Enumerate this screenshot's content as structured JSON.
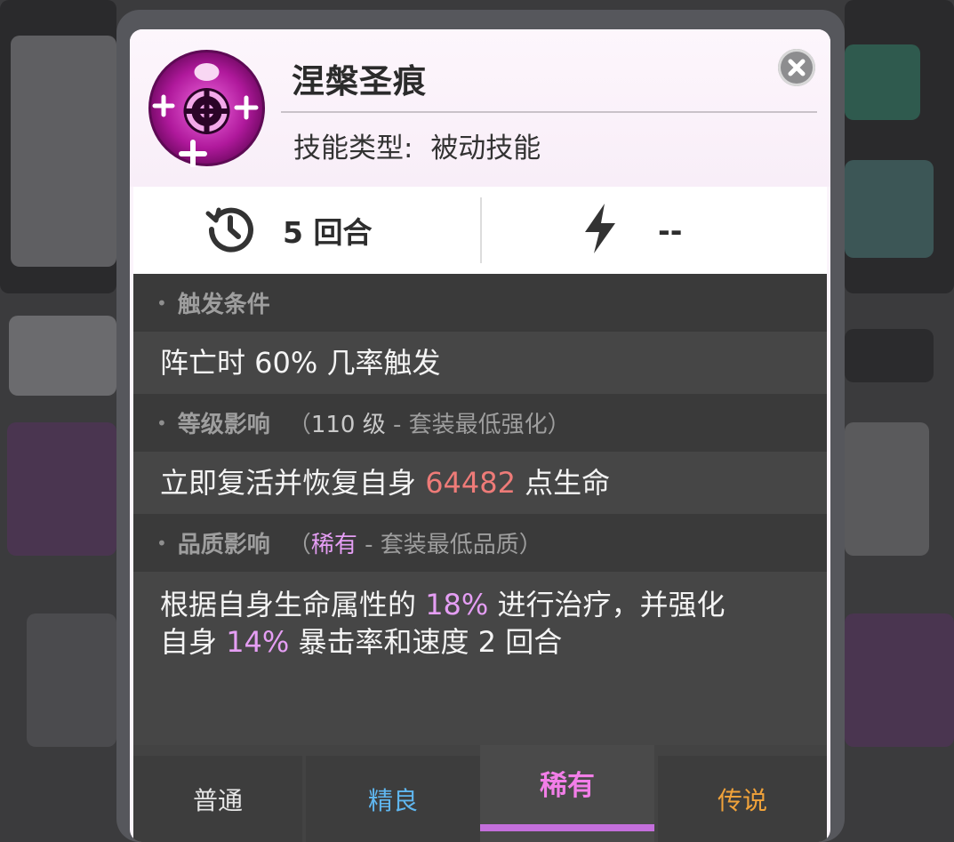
{
  "skill": {
    "name": "涅槃圣痕",
    "type_label": "技能类型:",
    "type_value": "被动技能",
    "cooldown": "5 回合",
    "energy": "--"
  },
  "sections": {
    "trigger": {
      "title": "触发条件",
      "desc": "阵亡时 60% 几率触发"
    },
    "level": {
      "title": "等级影响",
      "note_open": "（",
      "note_level": "110 级",
      "note_suffix": " - 套装最低强化）",
      "desc_prefix": "立即复活并恢复自身 ",
      "desc_value": "64482",
      "desc_suffix": " 点生命"
    },
    "quality": {
      "title": "品质影响",
      "note_open": "（",
      "note_quality": "稀有",
      "note_suffix": " - 套装最低品质）",
      "line1_prefix": "根据自身生命属性的 ",
      "line1_value": "18%",
      "line1_suffix": " 进行治疗，并强化",
      "line2_prefix": "自身 ",
      "line2_value": "14%",
      "line2_suffix": " 暴击率和速度 2 回合"
    }
  },
  "tabs": [
    {
      "label": "普通",
      "color": "#e6e6e6"
    },
    {
      "label": "精良",
      "color": "#5fb6ef"
    },
    {
      "label": "稀有",
      "color": "#f27ee8",
      "active": true
    },
    {
      "label": "传说",
      "color": "#f0a23a"
    }
  ],
  "colors": {
    "highlight_value": "#ee7b78",
    "highlight_rare": "#e59ef4",
    "accent_rare": "#c46fdc"
  },
  "icons": {
    "skill": "phoenix-cross-emblem-icon",
    "cooldown": "clock-history-icon",
    "energy": "lightning-bolt-icon",
    "close": "close-icon"
  }
}
